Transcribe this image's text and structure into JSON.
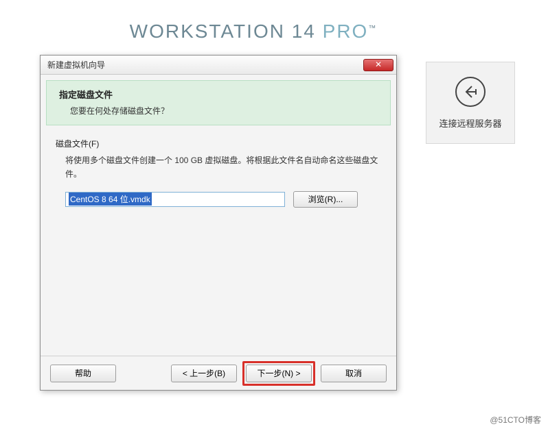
{
  "brand": {
    "main": "WORKSTATION 14 ",
    "pro": "PRO",
    "tm": "™"
  },
  "side_panel": {
    "label": "连接远程服务器"
  },
  "dialog": {
    "title": "新建虚拟机向导",
    "close_glyph": "✕",
    "header_title": "指定磁盘文件",
    "header_sub": "您要在何处存储磁盘文件？",
    "section_label": "磁盘文件(F)",
    "description": "将使用多个磁盘文件创建一个 100 GB 虚拟磁盘。将根据此文件名自动命名这些磁盘文件。",
    "file_value": "CentOS 8 64 位.vmdk",
    "browse": "浏览(R)...",
    "buttons": {
      "help": "帮助",
      "back": "< 上一步(B)",
      "next": "下一步(N) >",
      "cancel": "取消"
    }
  },
  "watermark": "@51CTO博客"
}
